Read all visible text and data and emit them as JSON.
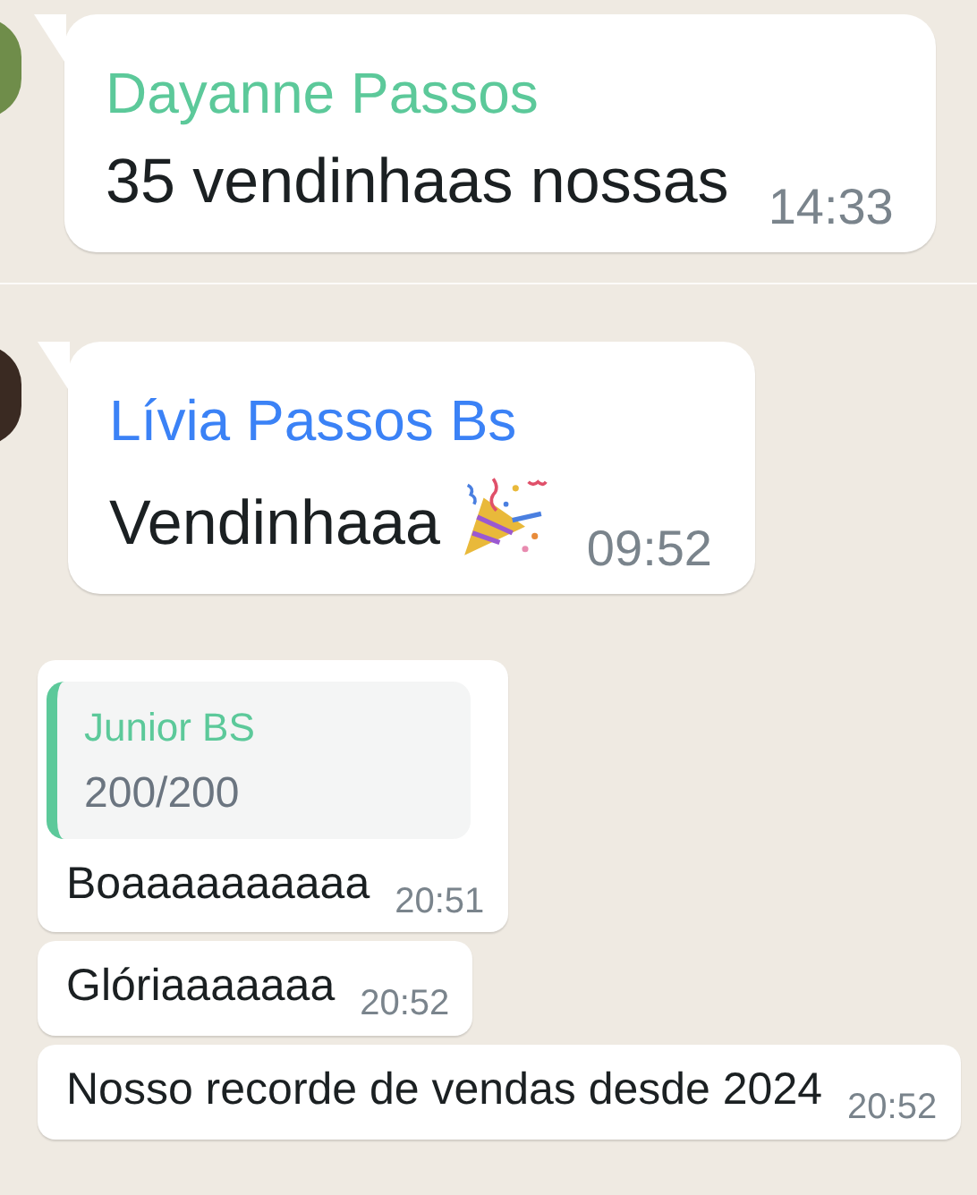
{
  "messages": [
    {
      "kind": "sender",
      "avatar": true,
      "tail": true,
      "sender": "Dayanne Passos",
      "color": "#5cc99a",
      "text": "35 vendinhaas nossas",
      "time": "14:33"
    },
    {
      "kind": "sender",
      "avatar": true,
      "tail": true,
      "sender": "Lívia Passos Bs",
      "color": "#3b82f6",
      "text": "Vendinhaaa",
      "time": "09:52",
      "party_popper": true
    },
    {
      "kind": "reply",
      "quote": {
        "author": "Junior BS",
        "color": "#5cc99a",
        "text": "200/200"
      },
      "text": "Boaaaaaaaaaa",
      "time": "20:51"
    },
    {
      "kind": "text",
      "text": "Glóriaaaaaaa",
      "time": "20:52"
    },
    {
      "kind": "text",
      "text": "Nosso recorde de vendas desde 2024",
      "time": "20:52"
    }
  ]
}
